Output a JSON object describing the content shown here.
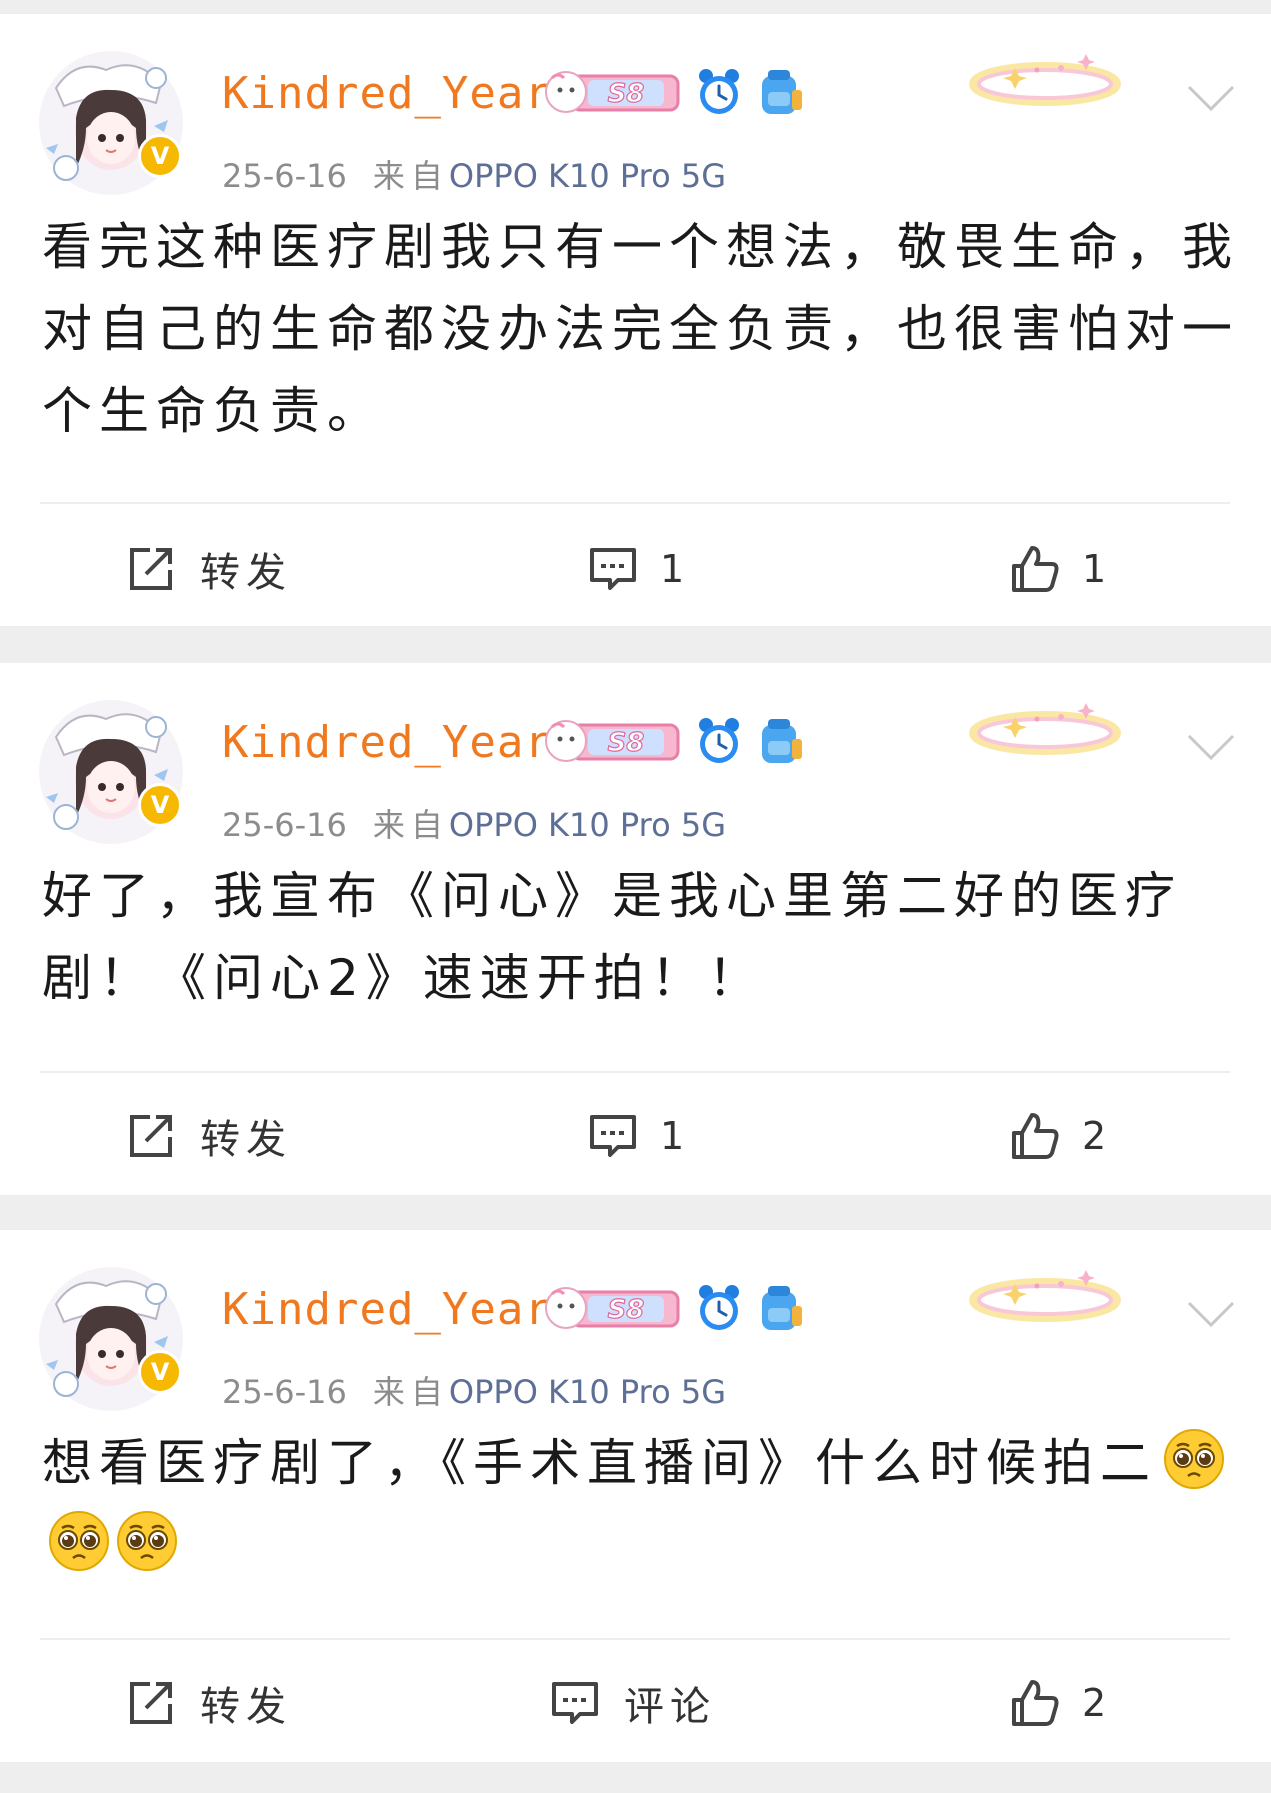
{
  "colors": {
    "username": "#f0781e",
    "device": "#5d6f95",
    "meta": "#8c8c8c",
    "badge_gold": "#f6b800",
    "separator": "#eeeeee"
  },
  "posts": [
    {
      "username": "Kindred_Yearn",
      "level_badge": "S8",
      "date": "25-6-16",
      "source_prefix": "来自",
      "device": "OPPO K10 Pro 5G",
      "content": "看完这种医疗剧我只有一个想法，敬畏生命，我对自己的生命都没办法完全负责，也很害怕对一个生命负责。",
      "emoji_count": 0,
      "repost_label": "转发",
      "comment_count": "1",
      "like_count": "1"
    },
    {
      "username": "Kindred_Yearn",
      "level_badge": "S8",
      "date": "25-6-16",
      "source_prefix": "来自",
      "device": "OPPO K10 Pro 5G",
      "content": "好了，我宣布《问心》是我心里第二好的医疗剧！《问心2》速速开拍！！",
      "emoji_count": 0,
      "repost_label": "转发",
      "comment_count": "1",
      "like_count": "2"
    },
    {
      "username": "Kindred_Yearn",
      "level_badge": "S8",
      "date": "25-6-16",
      "source_prefix": "来自",
      "device": "OPPO K10 Pro 5G",
      "content": "想看医疗剧了，《手术直播间》什么时候拍二",
      "emoji_count": 3,
      "emoji_name": "pleading-face-emoji",
      "repost_label": "转发",
      "comment_label": "评论",
      "like_count": "2"
    }
  ]
}
